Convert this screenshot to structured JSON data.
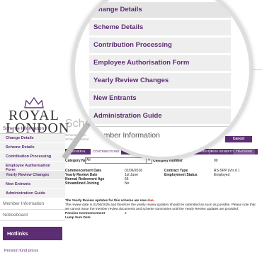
{
  "logo": {
    "line1": "ROYAL",
    "line2": "LONDON"
  },
  "sidebar": {
    "section_title": "Scheme Information",
    "items": [
      {
        "label": "Change Details"
      },
      {
        "label": "Scheme Details"
      },
      {
        "label": "Contribution Processing"
      },
      {
        "label": "Employee Authorisation Form"
      },
      {
        "label": "Yearly Review Changes"
      },
      {
        "label": "New Entrants"
      },
      {
        "label": "Administration Guide"
      }
    ],
    "member_info": "Member Information",
    "noticeboard": "Noticeboard",
    "hotlinks_title": "Hotlinks",
    "hotlink_item": "Pension fund prices"
  },
  "magnifier": {
    "items": [
      {
        "label": "Change Details"
      },
      {
        "label": "Scheme Details"
      },
      {
        "label": "Contribution Processing"
      },
      {
        "label": "Employee Authorisation Form"
      },
      {
        "label": "Yearly Review Changes"
      },
      {
        "label": "New Entrants"
      },
      {
        "label": "Administration Guide"
      }
    ],
    "member_info": "Member Information"
  },
  "main": {
    "title": "Sche",
    "scheme_name_label": "Scheme Name",
    "scheme_number_label": "Scheme Number",
    "cancel_label": "Cancel",
    "tabs": [
      {
        "label": "GENERAL"
      },
      {
        "label": "CONTRIBUTIONS"
      },
      {
        "label": "INVESTMENTS"
      },
      {
        "label": "RISK BENEFITS"
      },
      {
        "label": "TRACKING"
      }
    ],
    "category_name_label": "Category Name",
    "category_name_value": "All",
    "category_number_label": "Category Number",
    "category_number_value": "00",
    "commencement_label": "Commencement Date",
    "commencement_value": "01/06/2016",
    "contract_type_label": "Contract Type",
    "contract_type_value": "RS-SPP (Vrs 6 )",
    "review_date_label": "Yearly Review Date",
    "review_date_value": "1st June",
    "employment_status_label": "Employment Status",
    "employment_status_value": "Employed",
    "nra_label": "Normal Retirement Age",
    "nra_value": "65",
    "streamlined_label": "Streamlined Joining",
    "streamlined_value": "No",
    "notice_heading": "The Yearly Review updates for this scheme are now",
    "notice_due": "due.",
    "notice_body": "The review date is 01/06/2025 and therefore the yearly review updates should be submitted as soon as possible. Please note that we cannot issue the member review documents and scheme summaries until the Yearly Review updates are provided.",
    "pension_commencement_label": "Pension Commencement",
    "pension_commencement_value": "2",
    "lump_sum_label": "Lump Sum Date"
  }
}
